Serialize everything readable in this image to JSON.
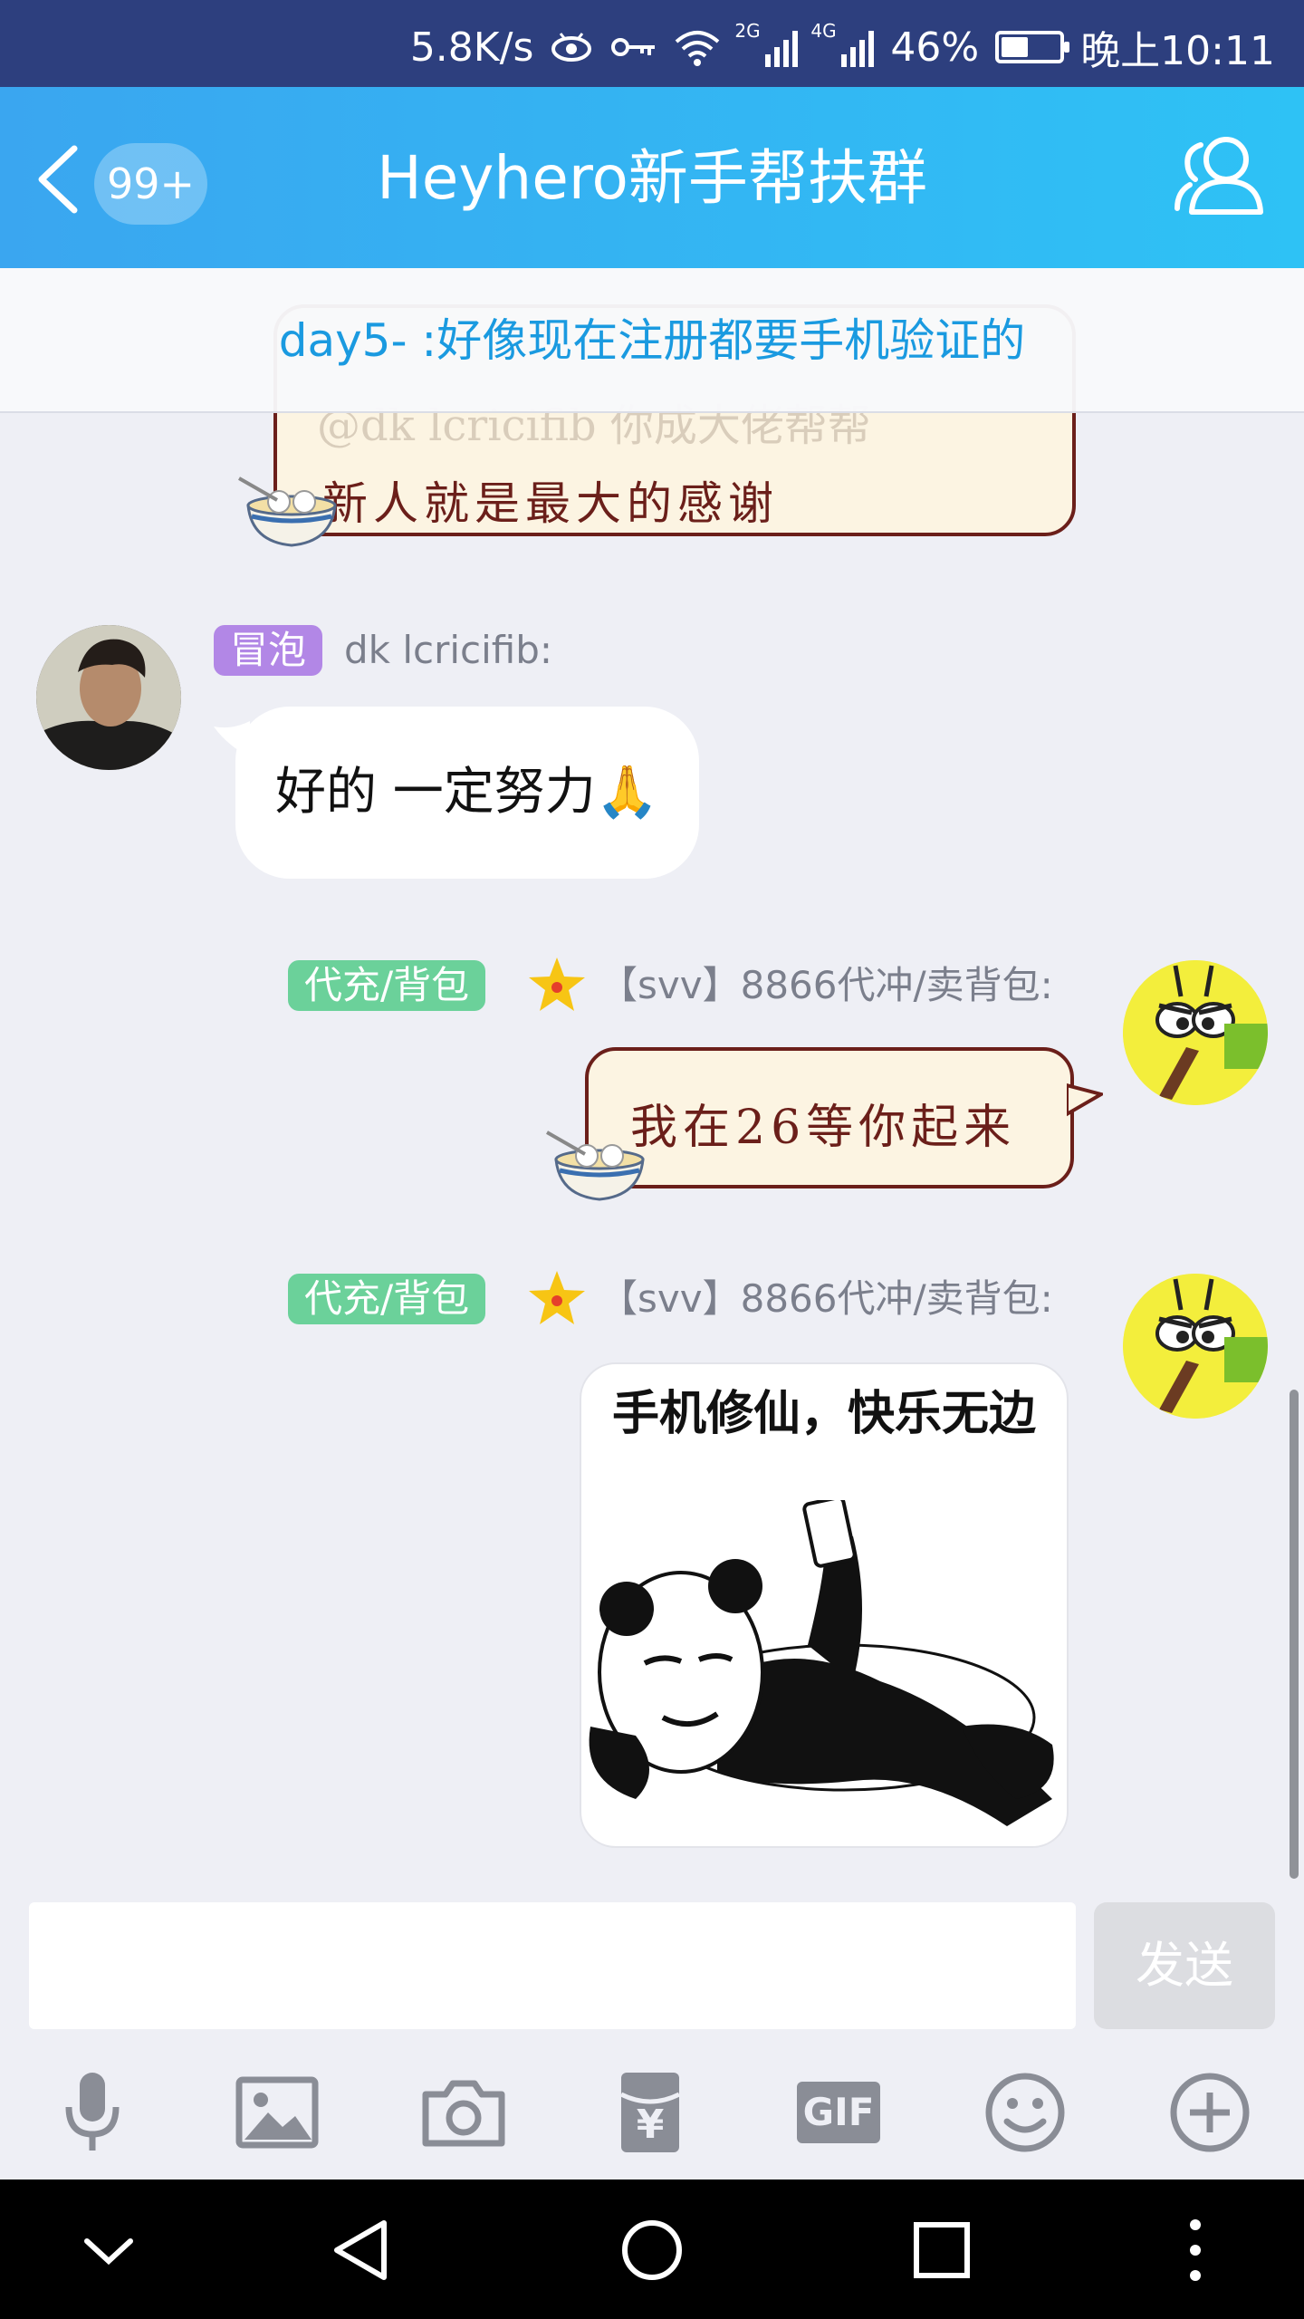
{
  "status_bar": {
    "net_speed": "5.8K/s",
    "sig_2g": "2G",
    "sig_4g": "4G",
    "battery": "46%",
    "battery_level": 0.46,
    "time": "晚上10:11"
  },
  "header": {
    "unread": "99+",
    "title": "Heyhero新手帮扶群"
  },
  "pinned_notice": "day5-    :好像现在注册都要手机验证的",
  "messages": [
    {
      "kind": "paper",
      "faint_lines": [
        "@dk lcricifib 你成大佬帮帮",
        "新人就是最大的感谢"
      ]
    },
    {
      "kind": "text",
      "side": "left",
      "tag": "冒泡",
      "tag_color": "#b287e6",
      "sender": "dk lcricifib:",
      "text": "好的 一定努力🙏"
    },
    {
      "kind": "paper",
      "side": "right",
      "tag": "代充/背包",
      "tag_color": "#6bd19a",
      "sender": "【svv】8866代冲/卖背包:",
      "text": "我在26等你起来"
    },
    {
      "kind": "sticker",
      "side": "right",
      "tag": "代充/背包",
      "tag_color": "#6bd19a",
      "sender": "【svv】8866代冲/卖背包:",
      "caption": "手机修仙，快乐无边"
    }
  ],
  "composer": {
    "placeholder": "",
    "send_label": "发送"
  },
  "toolbar": {
    "items": [
      "microphone-icon",
      "image-icon",
      "camera-icon",
      "red-packet-icon",
      "gif-icon",
      "emoji-icon",
      "plus-icon"
    ],
    "gif_label": "GIF",
    "yuan_label": "¥"
  },
  "nav": [
    "hide-keyboard-icon",
    "back-icon",
    "home-icon",
    "recents-icon",
    "more-icon"
  ]
}
